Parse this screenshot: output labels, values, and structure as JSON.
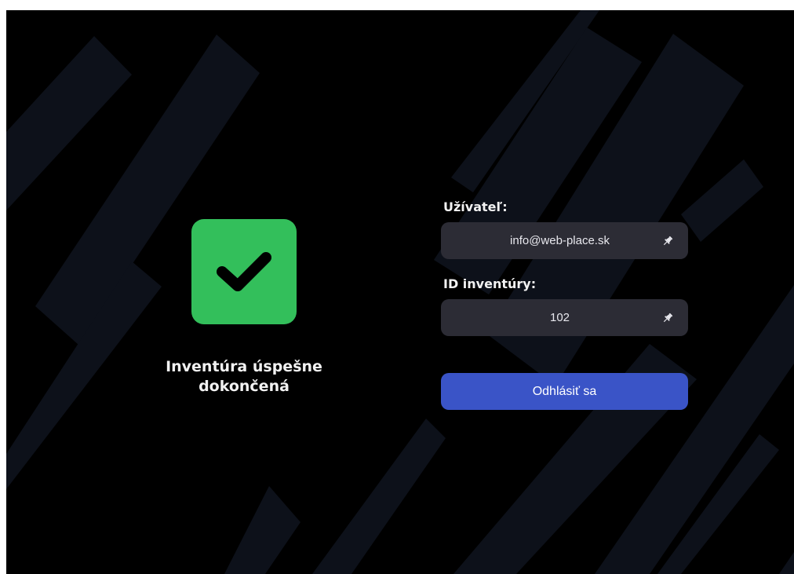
{
  "status": {
    "icon": "checkmark-icon",
    "title_line1": "Inventúra úspešne",
    "title_line2": "dokončená",
    "icon_color": "#33bf5b"
  },
  "user": {
    "label": "Užívateľ:",
    "value": "info@web-place.sk",
    "icon": "pin-icon"
  },
  "inventory": {
    "label": "ID inventúry:",
    "value": "102",
    "icon": "pin-icon"
  },
  "logout": {
    "label": "Odhlásiť sa",
    "color": "#3a54c7"
  },
  "theme": {
    "background": "#000000",
    "field_background": "#2c2c35",
    "stripe_color": "#0d111a"
  }
}
